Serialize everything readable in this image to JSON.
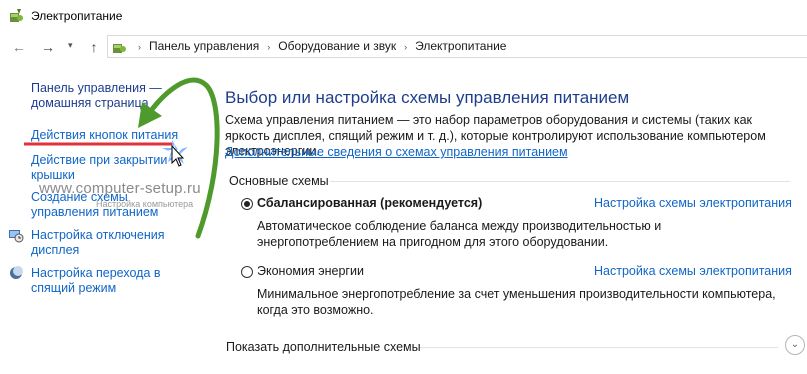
{
  "window": {
    "title": "Электропитание"
  },
  "nav": {
    "back": "←",
    "forward": "→",
    "dropdown": "▾",
    "up": "↑",
    "breadcrumbs": [
      "Панель управления",
      "Оборудование и звук",
      "Электропитание"
    ],
    "separator": "›"
  },
  "sidebar": {
    "home_link": "Панель управления — домашняя страница",
    "items": [
      {
        "label": "Действия кнопок питания"
      },
      {
        "label": "Действие при закрытии крышки"
      },
      {
        "label": "Создание схемы управления питанием"
      },
      {
        "label": "Настройка отключения дисплея"
      },
      {
        "label": "Настройка перехода в спящий режим"
      }
    ]
  },
  "watermark": {
    "site": "www.computer-setup.ru",
    "caption": "Настройка компьютера"
  },
  "main": {
    "title": "Выбор или настройка схемы управления питанием",
    "description": "Схема управления питанием — это набор параметров оборудования и системы (таких как яркость дисплея, спящий режим и т. д.), которые контролируют использование компьютером электроэнергии.",
    "more_link": "Дополнительные сведения о схемах управления питанием",
    "section_title": "Основные схемы",
    "plans": [
      {
        "name": "Сбалансированная (рекомендуется)",
        "selected": true,
        "settings_link": "Настройка схемы электропитания",
        "description": "Автоматическое соблюдение баланса между производительностью и энергопотреблением на пригодном для этого оборудовании."
      },
      {
        "name": "Экономия энергии",
        "selected": false,
        "settings_link": "Настройка схемы электропитания",
        "description": "Минимальное энергопотребление за счет уменьшения производительности компьютера, когда это возможно."
      }
    ],
    "show_more": "Показать дополнительные схемы",
    "expand_glyph": "⌄"
  },
  "colors": {
    "link_dark": "#1c3d8f",
    "link": "#1066c8",
    "annotation_arrow": "#4f9a2c",
    "annotation_underline": "#e0323a"
  }
}
